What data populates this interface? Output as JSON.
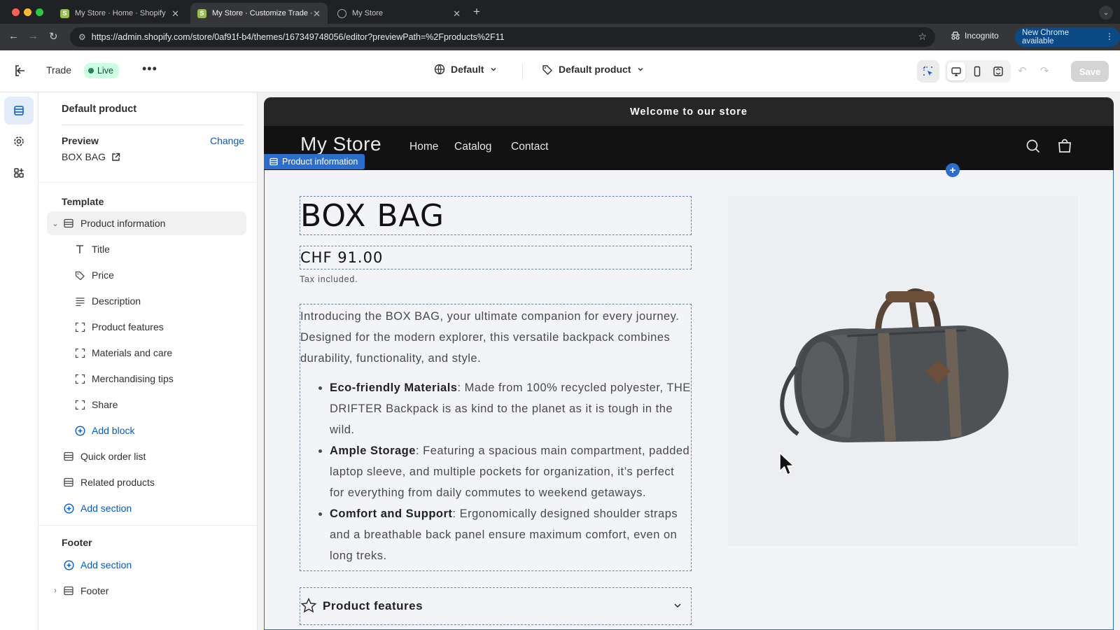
{
  "browser": {
    "tabs": [
      {
        "title": "My Store · Home · Shopify",
        "icon": "shopify-icon",
        "active": false
      },
      {
        "title": "My Store · Customize Trade ·",
        "icon": "shopify-icon",
        "active": true
      },
      {
        "title": "My Store",
        "icon": "globe-icon",
        "active": false
      }
    ],
    "url": "https://admin.shopify.com/store/0af91f-b4/themes/167349748056/editor?previewPath=%2Fproducts%2F11",
    "incognito_label": "Incognito",
    "new_chrome_label": "New Chrome available"
  },
  "editor": {
    "theme_name": "Trade",
    "live_label": "Live",
    "more_label": "•••",
    "context_select": "Default",
    "template_select": "Default product",
    "save_label": "Save"
  },
  "sidebar": {
    "heading": "Default product",
    "preview_label": "Preview",
    "change_label": "Change",
    "preview_value": "BOX BAG",
    "template_label": "Template",
    "section_name": "Product information",
    "blocks": [
      {
        "label": "Title",
        "icon": "text-icon"
      },
      {
        "label": "Price",
        "icon": "price-tag-icon"
      },
      {
        "label": "Description",
        "icon": "paragraph-icon"
      },
      {
        "label": "Product features",
        "icon": "block-icon"
      },
      {
        "label": "Materials and care",
        "icon": "block-icon"
      },
      {
        "label": "Merchandising tips",
        "icon": "block-icon"
      },
      {
        "label": "Share",
        "icon": "block-icon"
      }
    ],
    "add_block_label": "Add block",
    "sections": [
      {
        "label": "Quick order list"
      },
      {
        "label": "Related products"
      }
    ],
    "add_section_label": "Add section",
    "footer_label": "Footer",
    "footer_add_section_label": "Add section",
    "footer_section_label": "Footer"
  },
  "store": {
    "announcement": "Welcome to our store",
    "name": "My Store",
    "nav": [
      "Home",
      "Catalog",
      "Contact"
    ],
    "section_tag": "Product information",
    "product": {
      "title": "BOX BAG",
      "price": "CHF 91.00",
      "tax_note": "Tax included.",
      "intro": "Introducing the BOX BAG, your ultimate companion for every journey. Designed for the modern explorer, this versatile backpack combines durability, functionality, and style.",
      "bullets": [
        {
          "title": "Eco-friendly Materials",
          "text": ": Made from 100% recycled polyester, THE DRIFTER Backpack is as kind to the planet as it is tough in the wild."
        },
        {
          "title": "Ample Storage",
          "text": ": Featuring a spacious main compartment, padded laptop sleeve, and multiple pockets for organization, it’s perfect for everything from daily commutes to weekend getaways."
        },
        {
          "title": "Comfort and Support",
          "text": ": Ergonomically designed shoulder straps and a breathable back panel ensure maximum comfort, even on long treks."
        }
      ],
      "features_label": "Product features"
    }
  },
  "colors": {
    "accent_blue": "#005bd3",
    "selection_blue": "#2c6ecb",
    "live_green": "#29845a",
    "announcement_bg": "#262626",
    "header_bg": "#121212"
  }
}
